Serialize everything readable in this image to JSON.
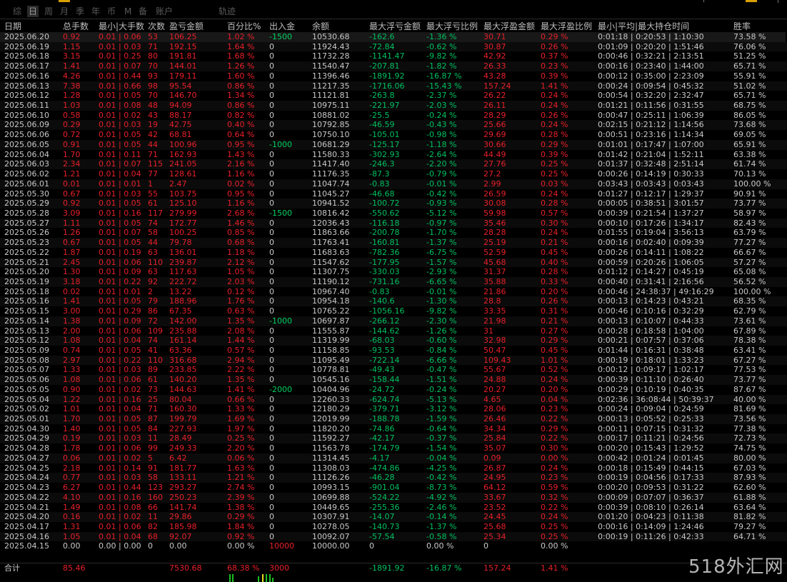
{
  "tabs": [
    "综",
    "日",
    "周",
    "月",
    "季",
    "年",
    "币",
    "M",
    "备",
    "账户",
    "轨迹"
  ],
  "active_tab_index": 1,
  "headers": {
    "date": "日期",
    "total": "总手数",
    "lot": "最小|大手数",
    "count": "次数",
    "pnl": "盈亏金额",
    "pct": "百分比%",
    "flow": "出入金",
    "balance": "余额",
    "dd_amt": "最大浮亏金额",
    "dd_pct": "最大浮亏比例",
    "fp_amt": "最大浮盈金额",
    "fp_pct": "最大浮盈比例",
    "time": "最小|平均|最大持仓时间",
    "win": "胜率"
  },
  "rows": [
    [
      "2025.06.20",
      "0.92",
      "0.01 | 0.06",
      "53",
      "106.25",
      "1.02 %",
      "-1500",
      "10530.68",
      "-162.6",
      "-1.36 %",
      "30.71",
      "0.29 %",
      "0:01:18 | 0:20:53 | 1:10:30",
      "73.58 %"
    ],
    [
      "2025.06.19",
      "1.15",
      "0.01 | 0.03",
      "71",
      "192.15",
      "1.64 %",
      "0",
      "11924.43",
      "-72.84",
      "-0.62 %",
      "30.87",
      "0.26 %",
      "0:01:09 | 0:20:20 | 1:51:46",
      "76.06 %"
    ],
    [
      "2025.06.18",
      "3.15",
      "0.01 | 0.25",
      "80",
      "191.81",
      "1.68 %",
      "0",
      "11732.28",
      "-1141.47",
      "-9.82 %",
      "42.92",
      "0.37 %",
      "0:00:46 | 0:32:21 | 2:13:51",
      "51.25 %"
    ],
    [
      "2025.06.17",
      "1.41",
      "0.01 | 0.07",
      "70",
      "144.01",
      "1.26 %",
      "0",
      "11540.47",
      "-207.81",
      "-1.82 %",
      "26.33",
      "0.23 %",
      "0:00:16 | 0:23:40 | 1:44:00",
      "65.71 %"
    ],
    [
      "2025.06.16",
      "4.26",
      "0.01 | 0.44",
      "93",
      "179.11",
      "1.60 %",
      "0",
      "11396.46",
      "-1891.92",
      "-16.87 %",
      "43.28",
      "0.39 %",
      "0:00:12 | 0:35:00 | 2:23:09",
      "55.91 %"
    ],
    [
      "2025.06.13",
      "7.38",
      "0.01 | 0.66",
      "98",
      "95.54",
      "0.86 %",
      "0",
      "11217.35",
      "-1716.06",
      "-15.43 %",
      "157.24",
      "1.41 %",
      "0:00:24 | 0:09:54 | 0:45:32",
      "51.02 %"
    ],
    [
      "2025.06.12",
      "1.28",
      "0.01 | 0.05",
      "70",
      "146.70",
      "1.34 %",
      "0",
      "11121.81",
      "-263.8",
      "-2.37 %",
      "26.22",
      "0.24 %",
      "0:00:54 | 0:32:20 | 2:32:47",
      "65.71 %"
    ],
    [
      "2025.06.11",
      "1.03",
      "0.01 | 0.08",
      "48",
      "94.09",
      "0.86 %",
      "0",
      "10975.11",
      "-221.97",
      "-2.03 %",
      "26.11",
      "0.24 %",
      "0:01:21 | 0:11:56 | 0:31:55",
      "68.75 %"
    ],
    [
      "2025.06.10",
      "0.58",
      "0.01 | 0.02",
      "43",
      "88.17",
      "0.82 %",
      "0",
      "10881.02",
      "-25.5",
      "-0.24 %",
      "28.29",
      "0.26 %",
      "0:00:47 | 0:25:11 | 1:06:39",
      "86.05 %"
    ],
    [
      "2025.06.09",
      "0.29",
      "0.01 | 0.03",
      "19",
      "42.75",
      "0.40 %",
      "0",
      "10792.85",
      "-46.59",
      "-0.43 %",
      "25.66",
      "0.24 %",
      "0:02:15 | 0:21:12 | 1:14:56",
      "73.68 %"
    ],
    [
      "2025.06.06",
      "0.72",
      "0.01 | 0.05",
      "42",
      "68.81",
      "0.64 %",
      "0",
      "10750.10",
      "-105.01",
      "-0.98 %",
      "29.69",
      "0.28 %",
      "0:00:51 | 0:23:16 | 1:14:34",
      "69.05 %"
    ],
    [
      "2025.06.05",
      "0.91",
      "0.01 | 0.05",
      "44",
      "100.96",
      "0.95 %",
      "-1000",
      "10681.29",
      "-125.17",
      "-1.18 %",
      "30.66",
      "0.29 %",
      "0:01:01 | 0:17:47 | 1:07:00",
      "65.91 %"
    ],
    [
      "2025.06.04",
      "1.70",
      "0.01 | 0.11",
      "71",
      "162.93",
      "1.43 %",
      "0",
      "11580.33",
      "-302.93",
      "-2.64 %",
      "44.49",
      "0.39 %",
      "0:01:42 | 0:21:04 | 1:52:11",
      "63.38 %"
    ],
    [
      "2025.06.03",
      "2.34",
      "0.01 | 0.07",
      "115",
      "241.05",
      "2.16 %",
      "0",
      "11417.40",
      "-246.3",
      "-2.20 %",
      "27.76",
      "0.25 %",
      "0:01:37 | 0:32:48 | 2:51:14",
      "61.74 %"
    ],
    [
      "2025.06.02",
      "1.21",
      "0.01 | 0.04",
      "77",
      "128.61",
      "1.16 %",
      "0",
      "11176.35",
      "-87.3",
      "-0.79 %",
      "27.2",
      "0.25 %",
      "0:00:26 | 0:14:19 | 0:30:33",
      "70.13 %"
    ],
    [
      "2025.06.01",
      "0.01",
      "0.01 | 0.01",
      "1",
      "2.47",
      "0.02 %",
      "0",
      "11047.74",
      "-0.83",
      "-0.01 %",
      "2.99",
      "0.03 %",
      "0:03:43 | 0:03:43 | 0:03:43",
      "100.00 %"
    ],
    [
      "2025.05.30",
      "0.67",
      "0.01 | 0.03",
      "55",
      "103.75",
      "0.95 %",
      "0",
      "11045.27",
      "-46.68",
      "-0.42 %",
      "26.59",
      "0.24 %",
      "0:01:27 | 0:12:17 | 1:29:37",
      "90.91 %"
    ],
    [
      "2025.05.29",
      "0.92",
      "0.01 | 0.05",
      "61",
      "125.10",
      "1.16 %",
      "0",
      "10941.52",
      "-100.72",
      "-0.93 %",
      "30.08",
      "0.28 %",
      "0:00:05 | 0:38:51 | 3:01:57",
      "73.77 %"
    ],
    [
      "2025.05.28",
      "3.09",
      "0.01 | 0.16",
      "117",
      "279.99",
      "2.68 %",
      "-1500",
      "10816.42",
      "-550.62",
      "-5.12 %",
      "59.98",
      "0.57 %",
      "0:00:39 | 0:21:54 | 1:37:27",
      "58.97 %"
    ],
    [
      "2025.05.27",
      "1.11",
      "0.01 | 0.05",
      "74",
      "172.77",
      "1.46 %",
      "0",
      "12036.43",
      "-116.18",
      "-0.97 %",
      "35.46",
      "0.30 %",
      "0:00:10 | 0:17:26 | 1:34:17",
      "82.43 %"
    ],
    [
      "2025.05.26",
      "1.26",
      "0.01 | 0.07",
      "58",
      "100.25",
      "0.85 %",
      "0",
      "11863.66",
      "-200.78",
      "-1.70 %",
      "28.28",
      "0.24 %",
      "0:01:55 | 0:19:04 | 3:56:13",
      "63.79 %"
    ],
    [
      "2025.05.23",
      "0.67",
      "0.01 | 0.05",
      "44",
      "79.78",
      "0.68 %",
      "0",
      "11763.41",
      "-160.81",
      "-1.37 %",
      "25.19",
      "0.21 %",
      "0:00:16 | 0:02:40 | 0:09:39",
      "77.27 %"
    ],
    [
      "2025.05.22",
      "1.87",
      "0.01 | 0.19",
      "63",
      "136.01",
      "1.18 %",
      "0",
      "11683.63",
      "-782.36",
      "-6.75 %",
      "52.59",
      "0.45 %",
      "0:00:26 | 0:14:11 | 1:08:22",
      "66.67 %"
    ],
    [
      "2025.05.21",
      "2.45",
      "0.01 | 0.06",
      "110",
      "239.87",
      "2.12 %",
      "0",
      "11547.62",
      "-177.95",
      "-1.57 %",
      "45.68",
      "0.40 %",
      "0:00:59 | 0:20:26 | 1:06:05",
      "57.27 %"
    ],
    [
      "2025.05.20",
      "1.30",
      "0.01 | 0.09",
      "63",
      "117.63",
      "1.05 %",
      "0",
      "11307.75",
      "-330.03",
      "-2.93 %",
      "31.37",
      "0.28 %",
      "0:01:12 | 0:14:27 | 0:45:19",
      "65.08 %"
    ],
    [
      "2025.05.19",
      "3.18",
      "0.01 | 0.22",
      "92",
      "222.72",
      "2.03 %",
      "0",
      "11190.12",
      "-731.16",
      "-6.65 %",
      "35.88",
      "0.33 %",
      "0:00:40 | 0:31:41 | 2:16:56",
      "56.52 %"
    ],
    [
      "2025.05.18",
      "0.02",
      "0.01 | 0.01",
      "2",
      "13.22",
      "0.12 %",
      "0",
      "10967.40",
      "-0.83",
      "-0.01 %",
      "21.86",
      "0.20 %",
      "0:00:46 | 24:38:37 | 49:16:29",
      "100.00 %"
    ],
    [
      "2025.05.16",
      "1.41",
      "0.01 | 0.05",
      "79",
      "188.96",
      "1.76 %",
      "0",
      "10954.18",
      "-140.6",
      "-1.30 %",
      "28.8",
      "0.26 %",
      "0:00:13 | 0:14:23 | 0:43:21",
      "68.35 %"
    ],
    [
      "2025.05.15",
      "3.00",
      "0.01 | 0.29",
      "86",
      "67.35",
      "0.63 %",
      "0",
      "10765.22",
      "-1056.16",
      "-9.82 %",
      "33.35",
      "0.31 %",
      "0:00:46 | 0:10:16 | 0:32:29",
      "62.79 %"
    ],
    [
      "2025.05.14",
      "1.38",
      "0.01 | 0.09",
      "72",
      "142.00",
      "1.35 %",
      "-1000",
      "10697.87",
      "-266.12",
      "-2.30 %",
      "21.98",
      "0.21 %",
      "0:00:13 | 0:10:07 | 0:44:33",
      "73.61 %"
    ],
    [
      "2025.05.13",
      "2.00",
      "0.01 | 0.06",
      "109",
      "235.88",
      "2.08 %",
      "0",
      "11555.87",
      "-144.62",
      "-1.26 %",
      "31",
      "0.27 %",
      "0:00:28 | 0:18:58 | 1:04:00",
      "67.89 %"
    ],
    [
      "2025.05.12",
      "1.08",
      "0.01 | 0.04",
      "74",
      "161.14",
      "1.44 %",
      "0",
      "11319.99",
      "-68.03",
      "-0.60 %",
      "32.98",
      "0.29 %",
      "0:00:21 | 0:07:57 | 0:37:06",
      "78.38 %"
    ],
    [
      "2025.05.09",
      "0.74",
      "0.01 | 0.05",
      "41",
      "63.36",
      "0.57 %",
      "0",
      "11158.85",
      "-93.53",
      "-0.84 %",
      "50.47",
      "0.45 %",
      "0:01:44 | 0:16:31 | 0:38:48",
      "63.41 %"
    ],
    [
      "2025.05.08",
      "2.97",
      "0.01 | 0.22",
      "110",
      "316.68",
      "2.94 %",
      "0",
      "11095.49",
      "-722.14",
      "-6.66 %",
      "109.43",
      "1.01 %",
      "0:00:19 | 0:18:01 | 1:33:23",
      "67.27 %"
    ],
    [
      "2025.05.07",
      "1.33",
      "0.01 | 0.03",
      "89",
      "233.85",
      "2.22 %",
      "0",
      "10778.81",
      "-49.43",
      "-0.47 %",
      "55.67",
      "0.52 %",
      "0:00:12 | 0:09:17 | 1:02:17",
      "77.53 %"
    ],
    [
      "2025.05.06",
      "1.08",
      "0.01 | 0.06",
      "61",
      "140.20",
      "1.35 %",
      "0",
      "10545.16",
      "-158.44",
      "-1.51 %",
      "24.88",
      "0.24 %",
      "0:00:39 | 0:11:10 | 0:26:40",
      "73.77 %"
    ],
    [
      "2025.05.05",
      "0.90",
      "0.01 | 0.02",
      "73",
      "144.63",
      "1.41 %",
      "-2000",
      "10404.96",
      "-24.72",
      "-0.24 %",
      "20.27",
      "0.20 %",
      "0:00:29 | 0:10:19 | 0:40:35",
      "87.67 %"
    ],
    [
      "2025.05.04",
      "1.22",
      "0.01 | 0.16",
      "25",
      "80.04",
      "0.66 %",
      "0",
      "12260.33",
      "-624.74",
      "-5.13 %",
      "4.65",
      "0.04 %",
      "0:02:36 | 36:08:44 | 50:39:37",
      "40.00 %"
    ],
    [
      "2025.05.02",
      "1.01",
      "0.01 | 0.04",
      "71",
      "160.30",
      "1.33 %",
      "0",
      "12180.29",
      "-379.71",
      "-3.12 %",
      "28.06",
      "0.23 %",
      "0:00:24 | 0:09:04 | 0:24:59",
      "81.69 %"
    ],
    [
      "2025.05.01",
      "1.70",
      "0.01 | 0.05",
      "87",
      "199.79",
      "1.69 %",
      "0",
      "12019.99",
      "-188.78",
      "-1.59 %",
      "26.46",
      "0.22 %",
      "0:00:13 | 0:05:52 | 0:25:33",
      "73.56 %"
    ],
    [
      "2025.04.30",
      "1.40",
      "0.01 | 0.05",
      "84",
      "227.93",
      "1.97 %",
      "0",
      "11820.20",
      "-74.86",
      "-0.64 %",
      "34.34",
      "0.29 %",
      "0:00:11 | 0:07:15 | 0:31:32",
      "77.38 %"
    ],
    [
      "2025.04.29",
      "0.19",
      "0.01 | 0.03",
      "11",
      "28.49",
      "0.25 %",
      "0",
      "11592.27",
      "-42.17",
      "-0.37 %",
      "25.84",
      "0.22 %",
      "0:00:17 | 0:11:21 | 0:24:56",
      "72.73 %"
    ],
    [
      "2025.04.28",
      "1.78",
      "0.01 | 0.06",
      "99",
      "249.33",
      "2.20 %",
      "0",
      "11563.78",
      "-174.79",
      "-1.54 %",
      "35.07",
      "0.30 %",
      "0:00:20 | 0:15:43 | 1:29:52",
      "74.75 %"
    ],
    [
      "2025.04.27",
      "0.06",
      "0.01 | 0.02",
      "5",
      "6.42",
      "0.06 %",
      "0",
      "11314.45",
      "-4.17",
      "-0.04 %",
      "0.09",
      "0.00 %",
      "0:00:42 | 0:01:24 | 0:01:45",
      "80.00 %"
    ],
    [
      "2025.04.25",
      "2.18",
      "0.01 | 0.14",
      "91",
      "181.77",
      "1.63 %",
      "0",
      "11308.03",
      "-474.86",
      "-4.25 %",
      "26.87",
      "0.24 %",
      "0:00:18 | 0:15:49 | 0:44:15",
      "67.03 %"
    ],
    [
      "2025.04.24",
      "0.77",
      "0.01 | 0.03",
      "58",
      "133.11",
      "1.21 %",
      "0",
      "11126.26",
      "-46.28",
      "-0.42 %",
      "24.95",
      "0.23 %",
      "0:00:19 | 0:04:56 | 0:17:33",
      "87.93 %"
    ],
    [
      "2025.04.23",
      "6.27",
      "0.01 | 0.44",
      "123",
      "293.27",
      "2.74 %",
      "0",
      "10993.15",
      "-901.04",
      "-8.73 %",
      "64.12",
      "0.59 %",
      "0:00:20 | 0:09:53 | 0:31:22",
      "62.60 %"
    ],
    [
      "2025.04.22",
      "4.10",
      "0.01 | 0.16",
      "160",
      "250.23",
      "2.39 %",
      "0",
      "10699.88",
      "-524.22",
      "-4.92 %",
      "33.67",
      "0.32 %",
      "0:00:09 | 0:07:07 | 0:36:37",
      "61.88 %"
    ],
    [
      "2025.04.21",
      "1.49",
      "0.01 | 0.08",
      "66",
      "141.74",
      "1.38 %",
      "0",
      "10449.65",
      "-255.36",
      "-2.46 %",
      "23.52",
      "0.22 %",
      "0:00:39 | 0:08:10 | 0:26:14",
      "63.64 %"
    ],
    [
      "2025.04.20",
      "0.16",
      "0.01 | 0.02",
      "11",
      "29.86",
      "0.29 %",
      "0",
      "10307.91",
      "-14.07",
      "-0.14 %",
      "24.45",
      "0.24 %",
      "0:01:20 | 0:04:23 | 0:11:38",
      "81.82 %"
    ],
    [
      "2025.04.17",
      "1.31",
      "0.01 | 0.06",
      "82",
      "185.98",
      "1.84 %",
      "0",
      "10278.05",
      "-140.73",
      "-1.37 %",
      "25.68",
      "0.25 %",
      "0:00:16 | 0:14:09 | 1:24:46",
      "79.27 %"
    ],
    [
      "2025.04.16",
      "1.05",
      "0.01 | 0.04",
      "68",
      "92.07",
      "0.92 %",
      "0",
      "10092.07",
      "-57.54",
      "-0.58 %",
      "25.34",
      "0.25 %",
      "0:00:19 | 0:11:26 | 0:42:33",
      "64.71 %"
    ],
    [
      "2025.04.15",
      "0.00",
      "0.00 | 0.00",
      "0",
      "0.00",
      "0.00 %",
      "10000",
      "10000.00",
      "0",
      "0.00 %",
      "0",
      "0.00 %",
      "",
      ""
    ]
  ],
  "footer": {
    "label": "合计",
    "total": "85.46",
    "pnl": "7530.68",
    "pct": "68.38 %",
    "flow": "3000",
    "dd_amt": "-1891.92",
    "dd_pct": "-16.87 %",
    "fp_amt": "157.24",
    "fp_pct": "1.41 %"
  },
  "watermark": "518外汇网",
  "colors": {
    "loss_green": "#00c060",
    "profit_red": "#e8202a",
    "flow_in_green": "#00d060",
    "bg": "#000000"
  }
}
